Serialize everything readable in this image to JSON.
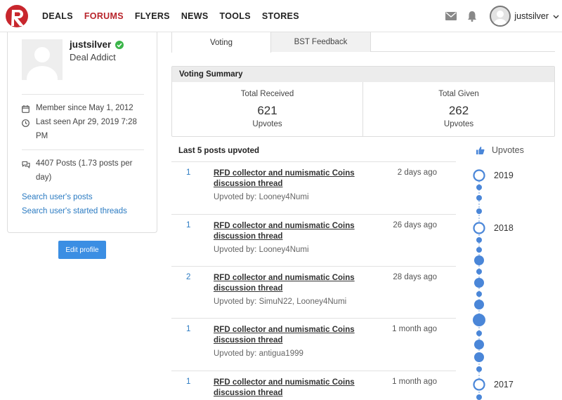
{
  "header": {
    "nav": [
      "DEALS",
      "FORUMS",
      "FLYERS",
      "NEWS",
      "TOOLS",
      "STORES"
    ],
    "active_nav": "FORUMS",
    "username": "justsilver",
    "icons": [
      "mail-icon",
      "bell-icon",
      "avatar",
      "chevron-down-icon"
    ]
  },
  "profile": {
    "name": "justsilver",
    "title": "Deal Addict",
    "member_since": "Member since May 1, 2012",
    "last_seen": "Last seen Apr 29, 2019 7:28 PM",
    "posts": "4407 Posts (1.73 posts per day)",
    "link_posts": "Search user's posts",
    "link_threads": "Search user's started threads",
    "edit_button": "Edit profile"
  },
  "tabs": {
    "voting": "Voting",
    "bst": "BST Feedback"
  },
  "summary": {
    "heading": "Voting Summary",
    "received_label": "Total Received",
    "received_value": "621",
    "received_unit": "Upvotes",
    "given_label": "Total Given",
    "given_value": "262",
    "given_unit": "Upvotes"
  },
  "posts_heading": "Last 5 posts upvoted",
  "posts": [
    {
      "count": "1",
      "title": "RFD collector and numismatic Coins discussion thread",
      "when": "2 days ago",
      "by": "Upvoted by: Looney4Numi"
    },
    {
      "count": "1",
      "title": "RFD collector and numismatic Coins discussion thread",
      "when": "26 days ago",
      "by": "Upvoted by: Looney4Numi"
    },
    {
      "count": "2",
      "title": "RFD collector and numismatic Coins discussion thread",
      "when": "28 days ago",
      "by": "Upvoted by: SimuN22, Looney4Numi"
    },
    {
      "count": "1",
      "title": "RFD collector and numismatic Coins discussion thread",
      "when": "1 month ago",
      "by": "Upvoted by: antigua1999"
    },
    {
      "count": "1",
      "title": "RFD collector and numismatic Coins discussion thread",
      "when": "1 month ago",
      "by": ""
    }
  ],
  "timeline": {
    "heading": "Upvotes",
    "years": [
      "2019",
      "2018",
      "2017"
    ]
  },
  "colors": {
    "brand_red": "#b8242b",
    "link_blue": "#2b7bc2",
    "button_blue": "#3b8ee3",
    "timeline_blue": "#4a86d8"
  }
}
